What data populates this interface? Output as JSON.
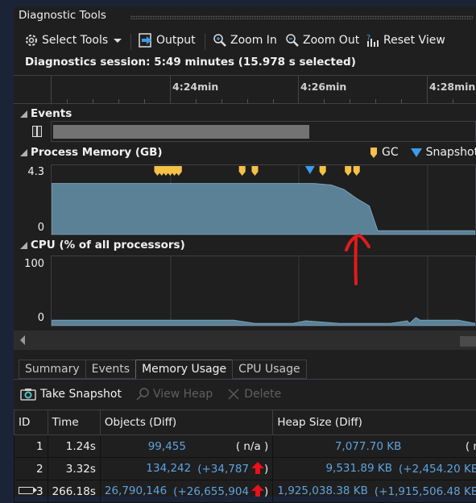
{
  "window": {
    "title": "Diagnostic Tools"
  },
  "toolbar": {
    "select_tools": "Select Tools",
    "output": "Output",
    "zoom_in": "Zoom In",
    "zoom_out": "Zoom Out",
    "reset_view": "Reset View"
  },
  "session": {
    "text": "Diagnostics session: 5:49 minutes (15.978 s selected)"
  },
  "ruler": {
    "labels": [
      "4:24min",
      "4:26min",
      "4:28min"
    ]
  },
  "events": {
    "title": "Events"
  },
  "memory": {
    "title": "Process Memory (GB)",
    "y_max_label": "4.3",
    "y_min_label": "0",
    "legend_gc": "GC",
    "legend_snapshot": "Snapshot",
    "colors": {
      "area": "#5b8197",
      "gc": "#f5c147",
      "snapshot": "#3d9be9"
    }
  },
  "cpu": {
    "title": "CPU (% of all processors)",
    "y_max_label": "100",
    "y_min_label": "0"
  },
  "chart_data": [
    {
      "type": "area",
      "title": "Process Memory (GB)",
      "ylim": [
        0,
        4.3
      ],
      "xlim_relative": [
        0,
        1
      ],
      "x": [
        0,
        0.62,
        0.66,
        0.69,
        0.72,
        0.75,
        0.77,
        1.0
      ],
      "values": [
        3.3,
        3.3,
        3.2,
        2.9,
        2.3,
        1.8,
        0.15,
        0.15
      ],
      "gc_markers": [
        0.25,
        0.26,
        0.27,
        0.28,
        0.29,
        0.3,
        0.45,
        0.48,
        0.64,
        0.7,
        0.72
      ],
      "snapshot_markers": [
        0.61
      ]
    },
    {
      "type": "area",
      "title": "CPU (% of all processors)",
      "ylim": [
        0,
        100
      ],
      "x": [
        0,
        0.43,
        0.48,
        0.57,
        0.6,
        0.68,
        0.8,
        0.84,
        0.845,
        0.85,
        0.86,
        0.87,
        0.96,
        1.0
      ],
      "values": [
        6,
        6,
        1,
        1,
        5,
        1,
        1,
        5,
        1,
        4,
        10,
        6,
        6,
        1
      ]
    }
  ],
  "tabs": [
    {
      "label": "Summary",
      "active": false
    },
    {
      "label": "Events",
      "active": false
    },
    {
      "label": "Memory Usage",
      "active": true
    },
    {
      "label": "CPU Usage",
      "active": false
    }
  ],
  "memory_toolbar": {
    "take_snapshot": "Take Snapshot",
    "view_heap": "View Heap",
    "delete": "Delete"
  },
  "table": {
    "headers": [
      "ID",
      "Time",
      "Objects (Diff)",
      "Heap Size (Diff)"
    ],
    "rows": [
      {
        "id": "1",
        "time": "1.24s",
        "objects": "99,455",
        "objects_diff": "( n/a )",
        "heap": "7,077.70 KB",
        "heap_diff": "( n/a )",
        "current": false,
        "increase": false
      },
      {
        "id": "2",
        "time": "3.32s",
        "objects": "134,242",
        "objects_diff": "(+34,787",
        "heap": "9,531.89 KB",
        "heap_diff": "(+2,454.20 KB",
        "current": false,
        "increase": true
      },
      {
        "id": "3",
        "time": "266.18s",
        "objects": "26,790,146",
        "objects_diff": "(+26,655,904",
        "heap": "1,925,038.38 KB",
        "heap_diff": "(+1,915,506.48 KB",
        "current": true,
        "increase": true
      }
    ],
    "close_paren": ")"
  },
  "annotation": {
    "color": "#e01b1b"
  }
}
